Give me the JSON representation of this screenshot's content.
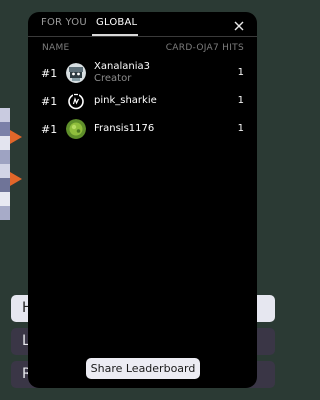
{
  "background": {
    "button_labels": [
      "H",
      "L",
      "R"
    ]
  },
  "leaderboard": {
    "tabs": [
      {
        "label": "FOR YOU",
        "active": false
      },
      {
        "label": "GLOBAL",
        "active": true
      }
    ],
    "close_icon": "close-icon",
    "columns": {
      "name": "NAME",
      "hits": "CARD-OJA7 HITS"
    },
    "rows": [
      {
        "rank": "#1",
        "username": "Xanalania3",
        "role": "Creator",
        "hits": "1",
        "avatar_icon": "avatar-icon"
      },
      {
        "rank": "#1",
        "username": "pink_sharkie",
        "role": "",
        "hits": "1",
        "avatar_icon": "avatar-icon"
      },
      {
        "rank": "#1",
        "username": "Fransis1176",
        "role": "",
        "hits": "1",
        "avatar_icon": "avatar-icon"
      }
    ],
    "share_label": "Share Leaderboard"
  },
  "colors": {
    "modal_bg": "#000000",
    "page_bg": "#2b3a34",
    "accent_orange": "#e2662a",
    "share_button_bg": "#ececf3"
  }
}
